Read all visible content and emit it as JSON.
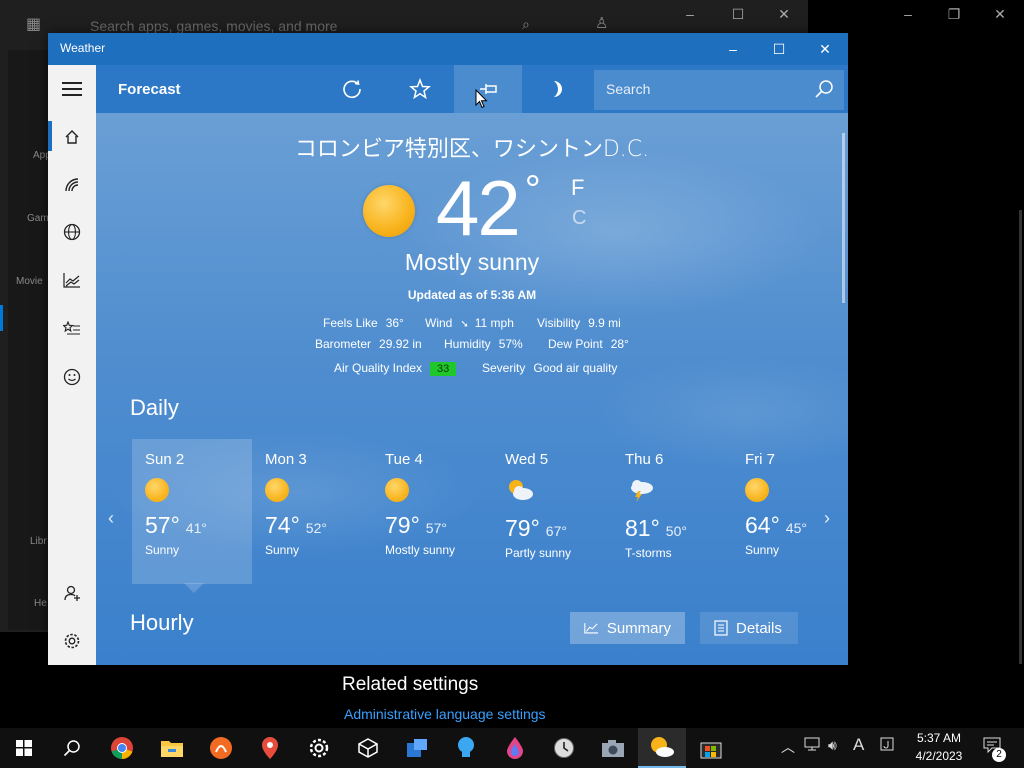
{
  "store": {
    "search_placeholder": "Search apps, games, movies, and more",
    "rail": [
      "App",
      "Gam",
      "Movie",
      "Libr",
      "He"
    ]
  },
  "settings": {
    "related_title": "Related settings",
    "link": "Administrative language settings"
  },
  "weather": {
    "app_title": "Weather",
    "window_buttons": {
      "minimize": "–",
      "maximize": "☐",
      "close": "✕"
    },
    "toolbar": {
      "title": "Forecast",
      "search_placeholder": "Search"
    },
    "location": "コロンビア特別区、ワシントンD.C.",
    "temperature": "42",
    "degree": "°",
    "unit_f": "F",
    "unit_c": "C",
    "condition": "Mostly sunny",
    "updated": "Updated as of 5:36 AM",
    "stats": {
      "feels_like": {
        "label": "Feels Like",
        "value": "36°"
      },
      "wind": {
        "label": "Wind",
        "value": "11 mph"
      },
      "visibility": {
        "label": "Visibility",
        "value": "9.9 mi"
      },
      "barometer": {
        "label": "Barometer",
        "value": "29.92 in"
      },
      "humidity": {
        "label": "Humidity",
        "value": "57%"
      },
      "dew_point": {
        "label": "Dew Point",
        "value": "28°"
      },
      "aqi": {
        "label": "Air Quality Index",
        "value": "33"
      },
      "severity": {
        "label": "Severity",
        "value": "Good air quality"
      }
    },
    "daily_title": "Daily",
    "hourly_title": "Hourly",
    "days": [
      {
        "name": "Sun 2",
        "hi": "57°",
        "lo": "41°",
        "cond": "Sunny",
        "icon": "sunny"
      },
      {
        "name": "Mon 3",
        "hi": "74°",
        "lo": "52°",
        "cond": "Sunny",
        "icon": "sunny"
      },
      {
        "name": "Tue 4",
        "hi": "79°",
        "lo": "57°",
        "cond": "Mostly sunny",
        "icon": "sunny"
      },
      {
        "name": "Wed 5",
        "hi": "79°",
        "lo": "67°",
        "cond": "Partly sunny",
        "icon": "partly-sunny"
      },
      {
        "name": "Thu 6",
        "hi": "81°",
        "lo": "50°",
        "cond": "T-storms",
        "icon": "t-storms"
      },
      {
        "name": "Fri 7",
        "hi": "64°",
        "lo": "45°",
        "cond": "Sunny",
        "icon": "sunny"
      }
    ],
    "summary_label": "Summary",
    "details_label": "Details"
  },
  "taskbar": {
    "time": "5:37 AM",
    "date": "4/2/2023",
    "notifications": "2",
    "ime": "A",
    "apps": [
      "start",
      "search",
      "chrome",
      "file-explorer",
      "app-orange",
      "maps",
      "settings",
      "3d-viewer",
      "people",
      "tips",
      "paint",
      "clock",
      "camera",
      "weather",
      "store"
    ]
  },
  "colors": {
    "accent": "#1f6fbf",
    "aqi_good": "#1fc72a"
  }
}
